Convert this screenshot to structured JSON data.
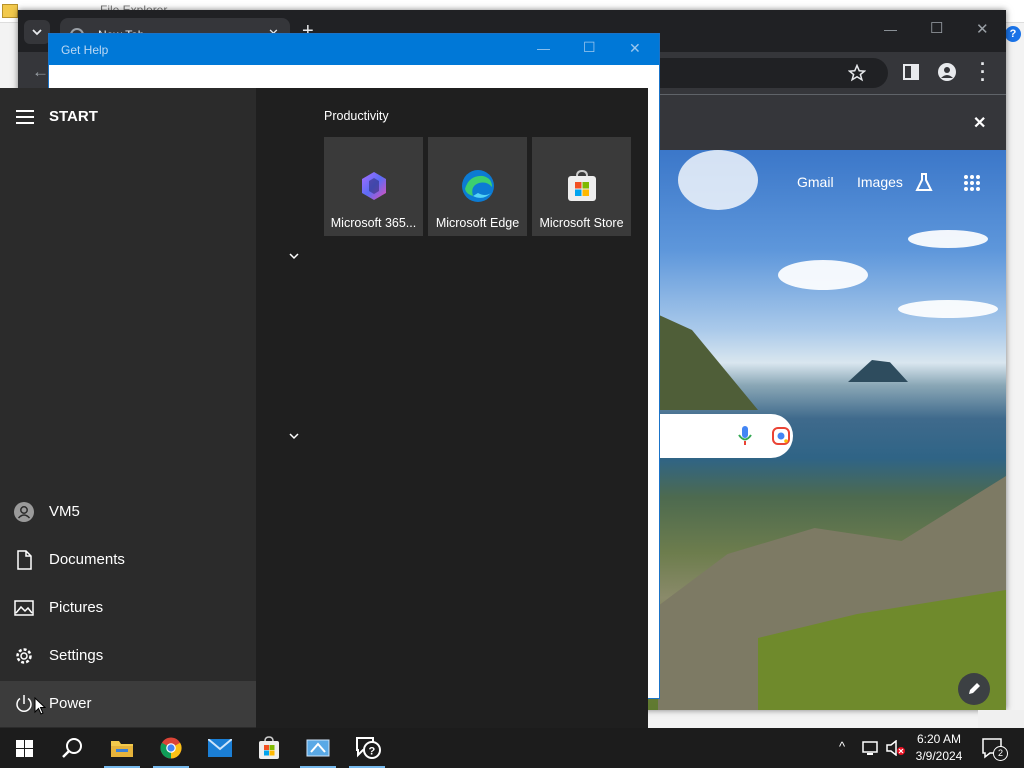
{
  "explorer": {
    "title": "File Explorer"
  },
  "chrome": {
    "tab_title": "New Tab",
    "new_tab_symbol": "+",
    "window_controls": [
      "—",
      "☐",
      "✕"
    ],
    "links": {
      "gmail": "Gmail",
      "images": "Images"
    },
    "infobar_close": "✕"
  },
  "get_help": {
    "title": "Get Help",
    "controls": [
      "—",
      "☐",
      "✕"
    ]
  },
  "start_menu": {
    "header": "START",
    "group_title": "Productivity",
    "tiles": [
      {
        "label": "Microsoft 365...",
        "icon": "microsoft-365-icon"
      },
      {
        "label": "Microsoft Edge",
        "icon": "edge-icon"
      },
      {
        "label": "Microsoft Store",
        "icon": "store-icon"
      }
    ],
    "left_items": [
      {
        "label": "VM5",
        "icon": "user-icon"
      },
      {
        "label": "Documents",
        "icon": "document-icon"
      },
      {
        "label": "Pictures",
        "icon": "pictures-icon"
      },
      {
        "label": "Settings",
        "icon": "gear-icon"
      },
      {
        "label": "Power",
        "icon": "power-icon"
      }
    ]
  },
  "taskbar": {
    "time": "6:20 AM",
    "date": "3/9/2024",
    "notification_count": "2"
  },
  "colors": {
    "accent": "#0078d7",
    "start_bg": "#1f1f1f",
    "start_left_bg": "#2b2b2b",
    "tile_bg": "#3a3a3a",
    "taskbar_bg": "#1c1c1c"
  }
}
